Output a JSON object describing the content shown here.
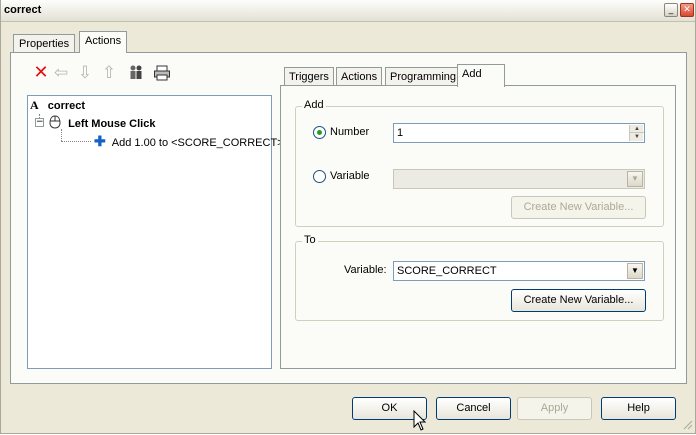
{
  "window": {
    "title": "correct",
    "minimize_icon": "minimize-icon",
    "close_icon": "close-icon"
  },
  "outer_tabs": [
    {
      "label": "Properties",
      "active": false
    },
    {
      "label": "Actions",
      "active": true
    }
  ],
  "toolbar": [
    {
      "name": "delete-icon",
      "glyph": "✕",
      "color": "#e01010"
    },
    {
      "name": "arrow-left-icon",
      "glyph": "⇦",
      "color": "#b5b5b5"
    },
    {
      "name": "arrow-down-icon",
      "glyph": "⇩",
      "color": "#b5b5b5"
    },
    {
      "name": "arrow-up-icon",
      "glyph": "⇧",
      "color": "#b5b5b5"
    },
    {
      "name": "users-icon",
      "glyph": "👥",
      "color": "#666666"
    },
    {
      "name": "print-icon",
      "glyph": "⎙",
      "color": "#333333"
    }
  ],
  "tree": {
    "root_label": "correct",
    "root_icon_glyph": "A",
    "event_label": "Left Mouse Click",
    "action_label": "Add 1.00 to <SCORE_CORRECT>",
    "expander_glyph": "−"
  },
  "inner_tabs": [
    {
      "label": "Triggers",
      "active": false
    },
    {
      "label": "Actions",
      "active": false
    },
    {
      "label": "Programming",
      "active": false
    },
    {
      "label": "Add",
      "active": true
    }
  ],
  "add_group": {
    "title": "Add",
    "number_label": "Number",
    "number_value": "1",
    "number_selected": true,
    "variable_label": "Variable",
    "variable_value": "",
    "variable_selected": false,
    "create_variable_label": "Create New Variable..."
  },
  "to_group": {
    "title": "To",
    "variable_label": "Variable:",
    "variable_value": "SCORE_CORRECT",
    "create_variable_label": "Create New Variable..."
  },
  "footer": {
    "ok": "OK",
    "cancel": "Cancel",
    "apply": "Apply",
    "help": "Help"
  },
  "colors": {
    "accent_red": "#e01010",
    "radio_green": "#21a121",
    "action_blue": "#1560c8"
  }
}
